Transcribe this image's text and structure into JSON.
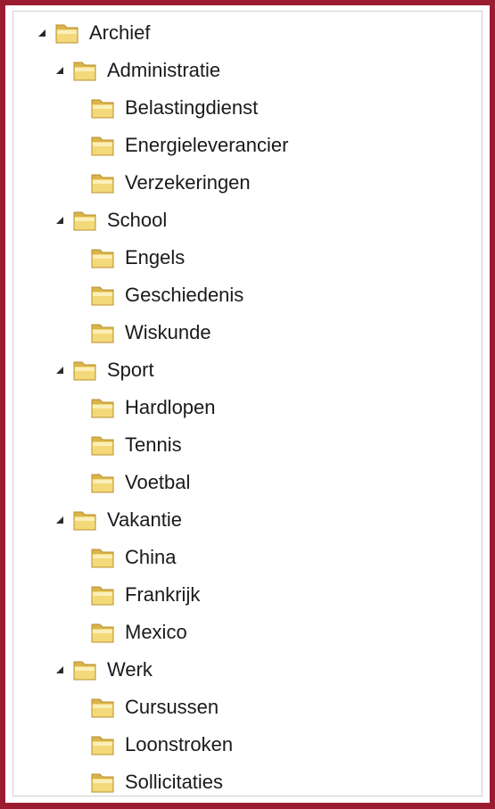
{
  "tree": {
    "root": {
      "label": "Archief",
      "expanded": true,
      "icon": "folder-icon",
      "children": [
        {
          "label": "Administratie",
          "expanded": true,
          "icon": "folder-icon",
          "children": [
            {
              "label": "Belastingdienst",
              "icon": "folder-icon"
            },
            {
              "label": "Energieleverancier",
              "icon": "folder-icon"
            },
            {
              "label": "Verzekeringen",
              "icon": "folder-icon"
            }
          ]
        },
        {
          "label": "School",
          "expanded": true,
          "icon": "folder-icon",
          "children": [
            {
              "label": "Engels",
              "icon": "folder-icon"
            },
            {
              "label": "Geschiedenis",
              "icon": "folder-icon"
            },
            {
              "label": "Wiskunde",
              "icon": "folder-icon"
            }
          ]
        },
        {
          "label": "Sport",
          "expanded": true,
          "icon": "folder-icon",
          "children": [
            {
              "label": "Hardlopen",
              "icon": "folder-icon"
            },
            {
              "label": "Tennis",
              "icon": "folder-icon"
            },
            {
              "label": "Voetbal",
              "icon": "folder-icon"
            }
          ]
        },
        {
          "label": "Vakantie",
          "expanded": true,
          "icon": "folder-icon",
          "children": [
            {
              "label": "China",
              "icon": "folder-icon"
            },
            {
              "label": "Frankrijk",
              "icon": "folder-icon"
            },
            {
              "label": "Mexico",
              "icon": "folder-icon"
            }
          ]
        },
        {
          "label": "Werk",
          "expanded": true,
          "icon": "folder-icon",
          "children": [
            {
              "label": "Cursussen",
              "icon": "folder-icon"
            },
            {
              "label": "Loonstroken",
              "icon": "folder-icon"
            },
            {
              "label": "Sollicitaties",
              "icon": "folder-icon"
            }
          ]
        }
      ]
    }
  },
  "colors": {
    "frame_border": "#9b1c31",
    "folder_fill": "#f3d97a",
    "folder_dark": "#d9b44a",
    "folder_light": "#fbefb9",
    "arrow": "#2b2b2b"
  }
}
